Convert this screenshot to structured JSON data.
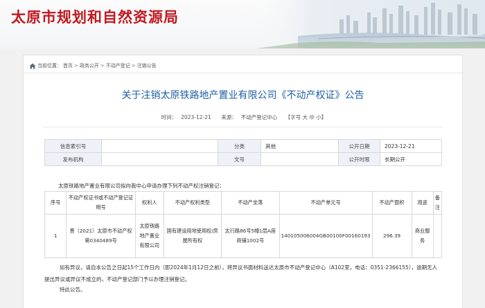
{
  "site": {
    "title": "太原市规划和自然资源局"
  },
  "breadcrumb": {
    "prefix": "当前位置：",
    "items": [
      "首页",
      "政务公开",
      "不动产登记",
      "注销公告"
    ],
    "sep": ">"
  },
  "article": {
    "title": "关于注销太原铁路地产置业有限公司《不动产权证》公告",
    "time_label": "时间：",
    "time": "2023-12-21",
    "source_label": "来源：",
    "source": "不动产登记中心",
    "font_label": "【字号 大 中 小】"
  },
  "info_table": {
    "rows": [
      [
        "信息索引号",
        "",
        "分类",
        "其他",
        "公开日期",
        "2023-12-21"
      ],
      [
        "发布机构",
        "",
        "文号",
        "",
        "公开时限",
        "长期公开"
      ]
    ]
  },
  "intro": "太原铁路地产置业有限公司拟向我中心申请办理下列不动产权注销登记：",
  "register_table": {
    "headers": [
      "序号",
      "不动产权证书或不动产登记证明号",
      "权利人",
      "不动产权利类型",
      "不动产坐落",
      "不动产单元号",
      "不动产面积",
      "用途",
      "备注"
    ],
    "rows": [
      [
        "1",
        "晋（2021）太原市不动产权第0340489号",
        "太原铁路地产置业有限公司",
        "国有建设用地使用权/房屋所有权",
        "太行路86号5幢1层A座商铺1002号",
        "140105006004GB00100F00160193",
        "296.39",
        "商业服务",
        ""
      ]
    ]
  },
  "notice": "如有异议，请自本公告之日起15个工作日内（即2024年1月12日之前），将异议书面材料送达太原市不动产登记中心（A102室，电话：0351-2366155），逾期无人提出异议或异议不成立的，不动产登记部门予以办理注销登记。",
  "sign": "特此公告。",
  "colors": {
    "brand": "#c21820",
    "title_blue": "#1f5fa5",
    "label_bg": "#eef1f7"
  }
}
